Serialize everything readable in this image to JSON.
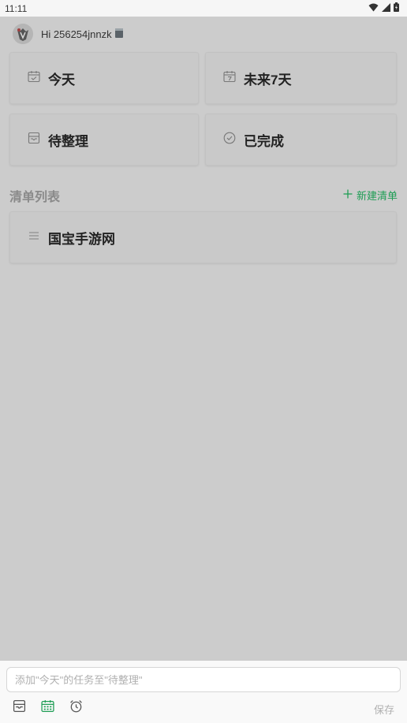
{
  "status_bar": {
    "time": "11:11"
  },
  "header": {
    "greeting": "Hi 256254jnnzk"
  },
  "cards": {
    "today": "今天",
    "next7": "未来7天",
    "inbox": "待整理",
    "done": "已完成"
  },
  "lists": {
    "section_title": "清单列表",
    "new_list_label": "新建清单",
    "items": [
      {
        "label": "国宝手游网"
      }
    ]
  },
  "bottom": {
    "input_placeholder": "添加\"今天\"的任务至\"待整理\"",
    "save_label": "保存"
  },
  "colors": {
    "accent": "#1f9d55",
    "background": "#cccccc",
    "muted": "#8a8a8a"
  },
  "icons": {
    "wifi": "wifi-icon",
    "signal": "signal-icon",
    "battery": "battery-icon",
    "today": "calendar-today-icon",
    "next7": "calendar-7-icon",
    "inbox": "inbox-icon",
    "done": "check-circle-icon",
    "list": "list-lines-icon",
    "add": "plus-icon",
    "alarm": "alarm-icon"
  }
}
